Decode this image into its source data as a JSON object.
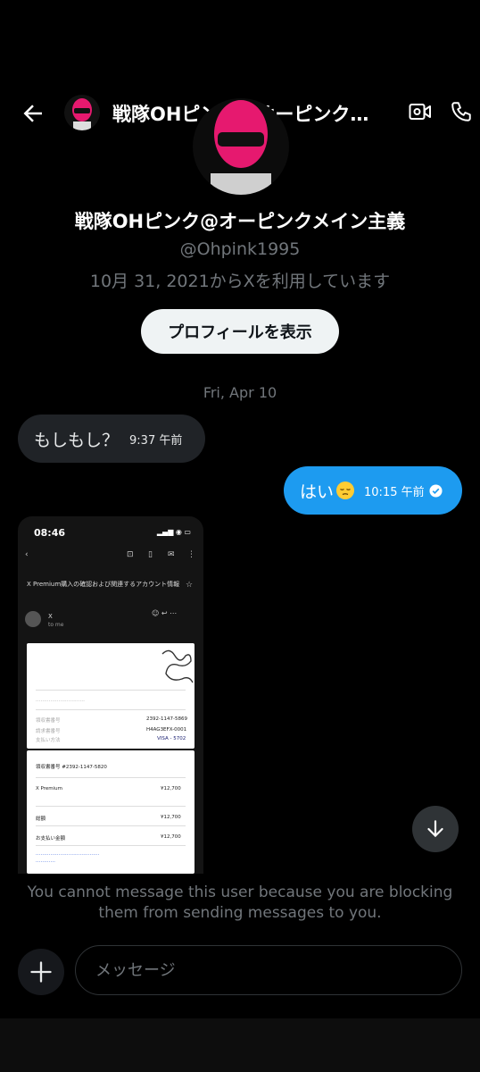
{
  "header": {
    "title": "戦隊OHピンク@オーピンク…",
    "back_icon": "arrow-left-icon",
    "video_icon": "video-camera-icon",
    "phone_icon": "phone-icon"
  },
  "profile": {
    "name": "戦隊OHピンク@オーピンクメイン主義",
    "handle": "@Ohpink1995",
    "since": "10月 31, 2021からXを利用しています",
    "view_profile_label": "プロフィールを表示"
  },
  "conversation": {
    "date_separator": "Fri, Apr 10",
    "messages": [
      {
        "direction": "incoming",
        "text": "もしもし？",
        "time": "9:37 午前"
      },
      {
        "direction": "outgoing",
        "text": "はい",
        "emoji": "pensive-face-emoji",
        "time": "10:15 午前",
        "status": "read"
      }
    ],
    "attachment": {
      "status_time": "08:46",
      "subject": "X Premium購入の確認および関連するアカウント情報",
      "sender": "X",
      "sender_sub": "to me",
      "receipt_number": "2392-1147-5869",
      "invoice_number": "H4AG3EFX-0001",
      "card_label": "VISA - 5702",
      "receipt_header": "領収書番号 #2392-1147-5820",
      "item_name": "X Premium",
      "item_price": "¥12,700",
      "total_label": "総額",
      "total_price": "¥12,700",
      "paid_label": "お支払い金額",
      "paid_price": "¥12,700"
    }
  },
  "footer": {
    "block_notice": "You cannot message this user because you are blocking them from sending messages to you.",
    "input_placeholder": "メッセージ",
    "add_icon": "plus-icon"
  },
  "colors": {
    "background": "#000000",
    "accent": "#1d9bf0",
    "muted_text": "#71767b",
    "incoming_bubble": "#202327"
  }
}
